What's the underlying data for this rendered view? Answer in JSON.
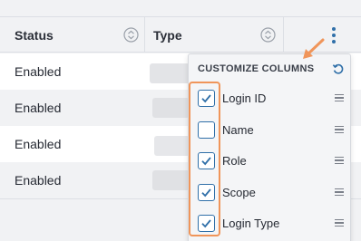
{
  "table": {
    "columns": [
      {
        "label": "Status",
        "sortable": true
      },
      {
        "label": "Type",
        "sortable": true
      }
    ],
    "rows": [
      {
        "status": "Enabled"
      },
      {
        "status": "Enabled"
      },
      {
        "status": "Enabled"
      },
      {
        "status": "Enabled"
      }
    ],
    "actions_icon": "kebab-menu-icon"
  },
  "customize_panel": {
    "title": "CUSTOMIZE COLUMNS",
    "reset_icon": "reset-icon",
    "items": [
      {
        "label": "Login ID",
        "checked": true
      },
      {
        "label": "Name",
        "checked": false
      },
      {
        "label": "Role",
        "checked": true
      },
      {
        "label": "Scope",
        "checked": true
      },
      {
        "label": "Login Type",
        "checked": true
      }
    ]
  },
  "colors": {
    "accent": "#2f6fa8",
    "annotation": "#f0955a",
    "row_alt": "#f1f2f4"
  }
}
